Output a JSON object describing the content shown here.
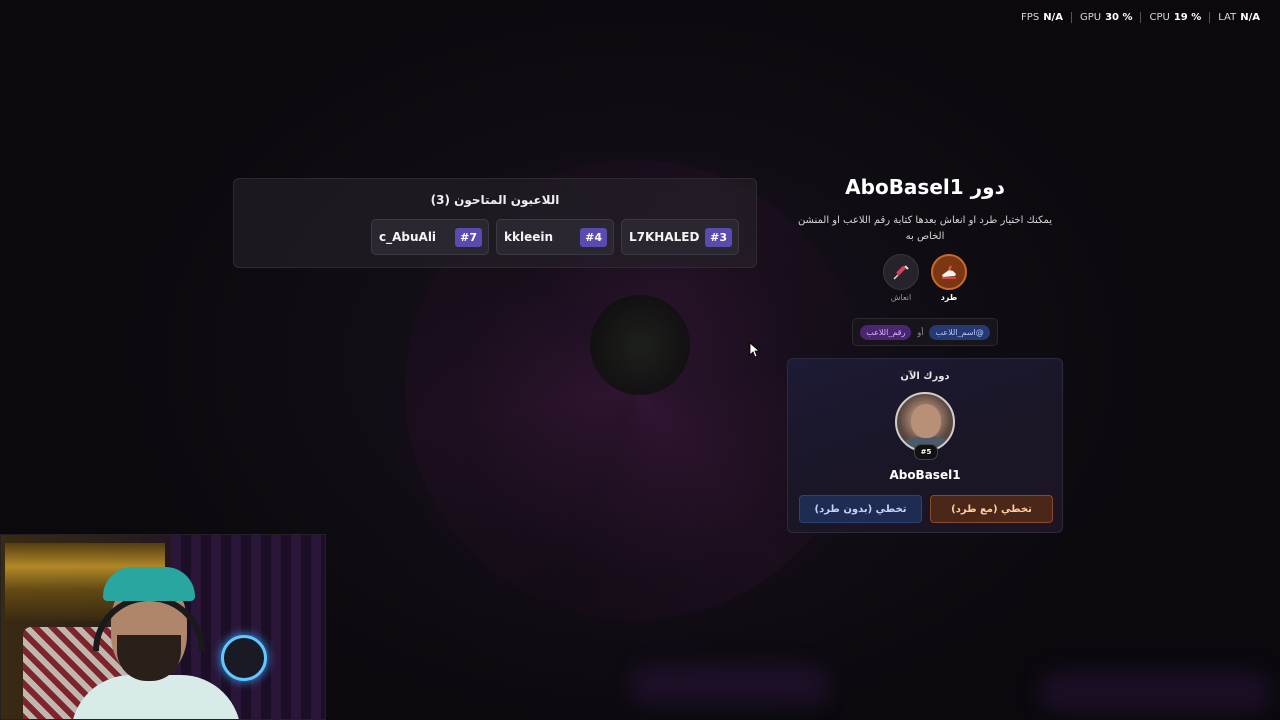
{
  "stats": [
    {
      "label": "FPS",
      "value": "N/A"
    },
    {
      "label": "GPU",
      "value": "30 %"
    },
    {
      "label": "CPU",
      "value": "19 %"
    },
    {
      "label": "LAT",
      "value": "N/A"
    }
  ],
  "players": {
    "title": "اللاعبون المتاحون (3)",
    "items": [
      {
        "name": "L7KHALED",
        "number": "#3"
      },
      {
        "name": "kkleein",
        "number": "#4"
      },
      {
        "name": "c_AbuAli",
        "number": "#7"
      }
    ]
  },
  "turn": {
    "title": "دور AboBasel1",
    "description": "يمكنك اختيار طرد او انعاش بعدها كتابة رقم اللاعب او المنشن الخاص به",
    "actions": {
      "kick_label": "طرد",
      "revive_label": "انعاش"
    },
    "command": {
      "name_tag": "@اسم_اللاعب",
      "or": "أو",
      "number_tag": "رقم_اللاعب"
    }
  },
  "current": {
    "label": "دورك الآن",
    "badge": "#5",
    "name": "AboBasel1",
    "skip_with_kick": "تخطي (مع طرد)",
    "skip_without_kick": "تخطي (بدون طرد)"
  },
  "colors": {
    "accent_purple": "#5b4bb0",
    "kick_orange": "#c86a2c",
    "blue_button": "#1f2c52"
  }
}
